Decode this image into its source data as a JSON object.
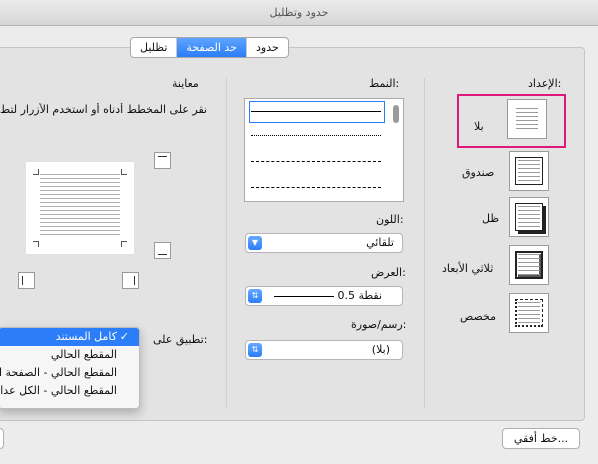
{
  "window": {
    "title": "حدود وتظليل"
  },
  "tabs": [
    {
      "label": "حدود",
      "active": false
    },
    {
      "label": "حد الصفحة",
      "active": true
    },
    {
      "label": "تظليل",
      "active": false
    }
  ],
  "setting": {
    "heading": "الإعداد:",
    "options": [
      {
        "label": "بلا",
        "selected": true
      },
      {
        "label": "صندوق",
        "selected": false
      },
      {
        "label": "ظل",
        "selected": false
      },
      {
        "label": "ثلاثي الأبعاد",
        "selected": false
      },
      {
        "label": "مخصص",
        "selected": false
      }
    ]
  },
  "style": {
    "heading": "النمط:"
  },
  "color": {
    "heading": "اللون:",
    "value": "تلقائي"
  },
  "width": {
    "heading": "العرض:",
    "value": "0.5 نقطة"
  },
  "art": {
    "heading": "رسم/صورة:",
    "value": "(بلا)"
  },
  "preview": {
    "heading": "معاينة",
    "instruction": "انقر على المخطط أدناه أو استخدم الأزرار لتط"
  },
  "apply_to": {
    "label": "تطبيق على:",
    "options": [
      {
        "label": "كامل المستند",
        "selected": true
      },
      {
        "label": "المقطع الحالي",
        "selected": false
      },
      {
        "label": "المقطع الحالي - الصفحة ا",
        "selected": false
      },
      {
        "label": "المقطع الحالي - الكل عدا",
        "selected": false
      }
    ]
  },
  "buttons": {
    "horizontal_line": "خط أفقي..."
  },
  "colors": {
    "accent": "#2b7df8",
    "highlight": "#e0187c"
  }
}
